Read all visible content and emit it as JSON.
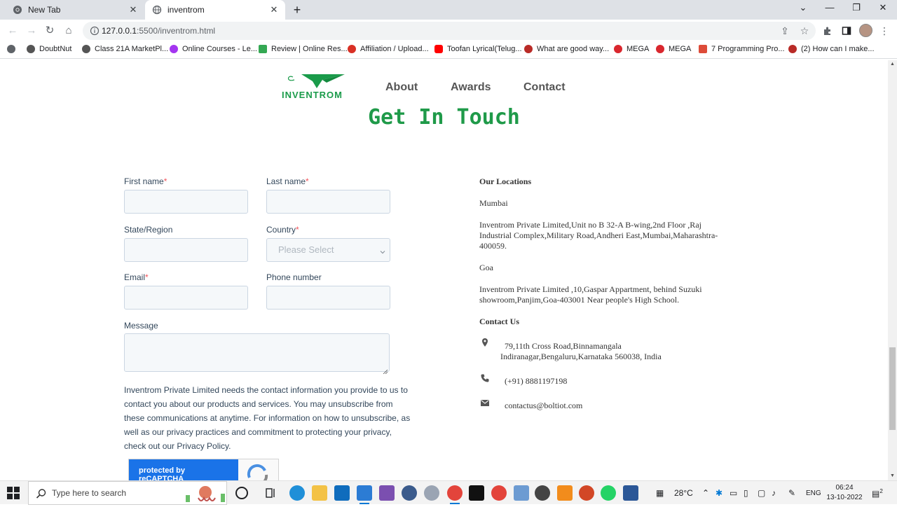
{
  "browser": {
    "tabs": [
      {
        "title": "New Tab",
        "active": false
      },
      {
        "title": "inventrom",
        "active": true
      }
    ],
    "url_host": "127.0.0.1",
    "url_path": ":5500/inventrom.html",
    "bookmarks": [
      {
        "label": "DoubtNut",
        "color": "#555555"
      },
      {
        "label": "Class 21A MarketPl...",
        "color": "#555555"
      },
      {
        "label": "Online Courses - Le...",
        "color": "#a435f0"
      },
      {
        "label": "Review | Online Res...",
        "color": "#34a853"
      },
      {
        "label": "Affiliation / Upload...",
        "color": "#d93025"
      },
      {
        "label": "Toofan Lyrical(Telug...",
        "color": "#ff0000"
      },
      {
        "label": "What are good way...",
        "color": "#b92b27"
      },
      {
        "label": "MEGA",
        "color": "#d9272e"
      },
      {
        "label": "MEGA",
        "color": "#d9272e"
      },
      {
        "label": "7 Programming Pro...",
        "color": "#dd4b39"
      },
      {
        "label": "(2) How can I make...",
        "color": "#b92b27"
      }
    ]
  },
  "site": {
    "logo_text": "INVENTROM",
    "nav": [
      "About",
      "Awards",
      "Contact"
    ],
    "headline": "Get In Touch",
    "form": {
      "first_name": "First name",
      "last_name": "Last name",
      "state": "State/Region",
      "country": "Country",
      "country_placeholder": "Please Select",
      "email": "Email",
      "phone": "Phone number",
      "message": "Message",
      "required_mark": "*",
      "legal": "Inventrom Private Limited needs the contact information you provide to us to contact you about our products and services. You may unsubscribe from these communications at anytime. For information on how to unsubscribe, as well as our privacy practices and commitment to protecting your privacy, check out our Privacy Policy.",
      "captcha": "protected by reCAPTCHA"
    },
    "info": {
      "locations_title": "Our Locations",
      "city1": "Mumbai",
      "addr1_line1": "Inventrom Private Limited,Unit no B 32-A B-wing,2nd Floor ,Raj",
      "addr1_line2": "Industrial Complex,Military Road,Andheri East,Mumbai,Maharashtra-",
      "addr1_line3": "400059.",
      "city2": "Goa",
      "addr2_line1": "Inventrom Private Limited ,10,Gaspar Appartment, behind Suzuki",
      "addr2_line2": "showroom,Panjim,Goa-403001 Near people's High School.",
      "contact_title": "Contact Us",
      "address_line1": "79,11th Cross Road,Binnamangala",
      "address_line2": "Indiranagar,Bengaluru,Karnataka 560038, India",
      "phone": "(+91) 8881197198",
      "email": "contactus@boltiot.com"
    }
  },
  "taskbar": {
    "search_placeholder": "Type here to search",
    "weather": "28°C",
    "language": "ENG",
    "time": "06:24",
    "date": "13-10-2022",
    "notifications": "2"
  }
}
